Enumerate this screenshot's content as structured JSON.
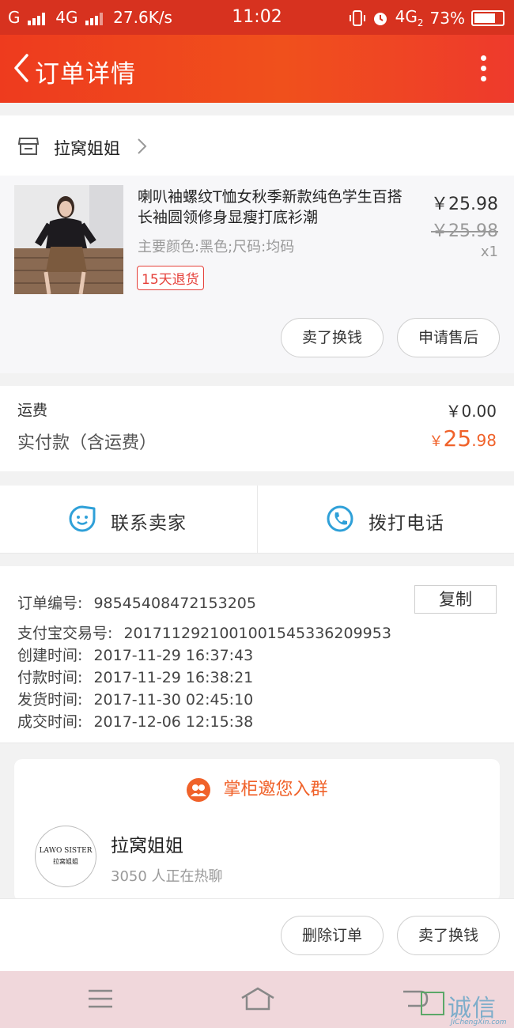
{
  "status_bar": {
    "carrier_left": "G",
    "network": "4G",
    "speed": "27.6K/s",
    "time": "11:02",
    "network_right": "4G",
    "network_right_sub": "2",
    "battery": "73%"
  },
  "nav": {
    "back_icon": "chevron-left-icon",
    "title": "订单详情",
    "more_icon": "more-vertical-icon"
  },
  "shop": {
    "icon": "store-icon",
    "name": "拉窝姐姐"
  },
  "product": {
    "title": "喇叭袖螺纹T恤女秋季新款纯色学生百搭长袖圆领修身显瘦打底衫潮",
    "spec": "主要颜色:黑色;尺码:均码",
    "tag": "15天退货",
    "price": "￥25.98",
    "original_price": "￥25.98",
    "quantity": "x1",
    "buttons": {
      "resell": "卖了换钱",
      "after_sale": "申请售后"
    }
  },
  "fees": {
    "shipping_label": "运费",
    "shipping_value": "￥0.00",
    "paid_label": "实付款（含运费）",
    "paid_currency": "￥",
    "paid_int": "25",
    "paid_dec": ".98"
  },
  "contact": {
    "seller_label": "联系卖家",
    "call_label": "拨打电话"
  },
  "order_info": {
    "copy_label": "复制",
    "rows": [
      {
        "label": "订单编号:",
        "value": "98545408472153205"
      },
      {
        "label": "支付宝交易号:",
        "value": "2017112921001001545336209953"
      },
      {
        "label": "创建时间:",
        "value": "2017-11-29 16:37:43"
      },
      {
        "label": "付款时间:",
        "value": "2017-11-29 16:38:21"
      },
      {
        "label": "发货时间:",
        "value": "2017-11-30 02:45:10"
      },
      {
        "label": "成交时间:",
        "value": "2017-12-06 12:15:38"
      }
    ]
  },
  "group": {
    "header": "掌柜邀您入群",
    "logo_line1": "LAWO SISTER",
    "logo_line2": "拉窝姐姐",
    "name": "拉窝姐姐",
    "count": "3050 人正在热聊"
  },
  "bottom_actions": {
    "delete": "删除订单",
    "resell": "卖了换钱"
  },
  "watermark": {
    "text": "诚信",
    "url": "JiChengXin.com"
  },
  "colors": {
    "accent": "#f0622a",
    "nav_red": "#ee3b1e",
    "tag_red": "#e5403a",
    "link_blue": "#2fa0d8"
  }
}
